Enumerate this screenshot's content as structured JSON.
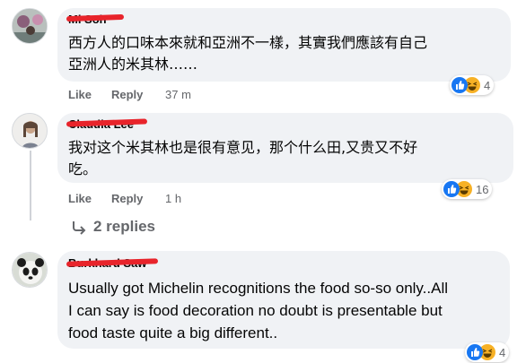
{
  "comments": [
    {
      "name": "Mi Soh",
      "text_lines": [
        "西方人的口味本來就和亞洲不一樣，其實我們應該有自己",
        "亞洲人的米其林……"
      ],
      "like": "Like",
      "reply": "Reply",
      "time": "37 m",
      "reaction_count": "4",
      "reactions": [
        "like-icon",
        "haha-icon"
      ]
    },
    {
      "name": "Claudia Lee",
      "text_lines": [
        "我对这个米其林也是很有意见，那个什么田,又贵又不好",
        "吃。"
      ],
      "like": "Like",
      "reply": "Reply",
      "time": "1 h",
      "reaction_count": "16",
      "reactions": [
        "like-icon",
        "haha-icon"
      ]
    },
    {
      "name": "Burkhard Saw",
      "text_lines": [
        "Usually got Michelin recognitions the food so-so only..All",
        "I can say is food decoration no doubt is presentable but",
        "food taste quite a big different.."
      ],
      "reaction_count": "4",
      "reactions": [
        "like-icon",
        "haha-icon"
      ]
    }
  ],
  "replies_link": "2 replies",
  "colors": {
    "bubble": "#f0f2f5",
    "muted": "#65676b",
    "like_blue": "#1877f2",
    "haha_yellow": "#f7b125",
    "redaction": "#e8242b"
  }
}
